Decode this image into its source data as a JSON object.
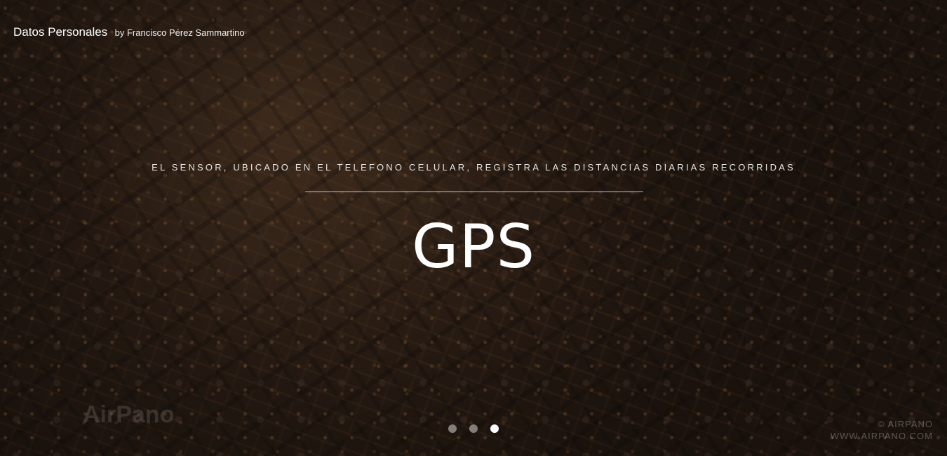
{
  "brand": {
    "title": "Datos Personales",
    "byline": "by Francisco Pérez Sammartino"
  },
  "slide": {
    "caption": "EL SENSOR, UBICADO EN EL TELEFONO CELULAR, REGISTRA LAS DISTANCIAS DIARIAS RECORRIDAS",
    "headline": "GPS"
  },
  "watermarks": {
    "left": "AirPano",
    "right_line1": "© AIRPANO",
    "right_line2": "WWW.AIRPANO.COM"
  },
  "carousel": {
    "total": 3,
    "active_index": 2
  },
  "colors": {
    "text": "#ffffff",
    "dot_inactive": "rgba(255,255,255,0.45)",
    "dot_active": "#ffffff"
  }
}
